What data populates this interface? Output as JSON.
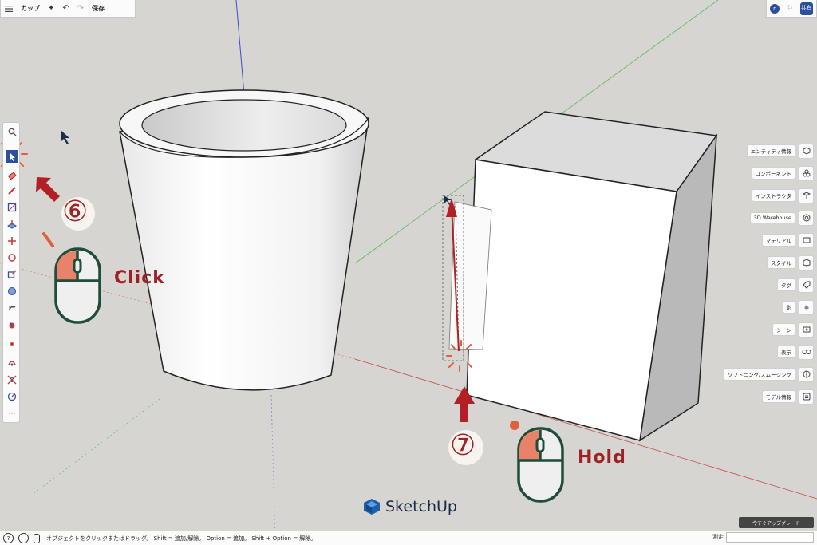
{
  "topbar": {
    "menu_icon": "hamburger-icon",
    "title": "カップ",
    "save_label": "保存"
  },
  "account": {
    "avatar_initial": "n",
    "share_label": "共有"
  },
  "left_tools": [
    "search-icon",
    "select-icon",
    "eraser-icon",
    "pencil-icon",
    "shape-icon",
    "push-pull-icon",
    "move-icon",
    "rotate-icon",
    "scale-icon",
    "paint-bucket-icon",
    "offset-icon",
    "tape-measure-icon",
    "follow-me-icon",
    "orbit-icon",
    "zoom-extents-icon",
    "more-icon"
  ],
  "panel": {
    "items": [
      {
        "label": "エンティティ情報",
        "icon": "entity-info-icon"
      },
      {
        "label": "コンポーネント",
        "icon": "components-icon"
      },
      {
        "label": "インストラクタ",
        "icon": "instructor-icon"
      },
      {
        "label": "3D Warehouse",
        "icon": "warehouse-icon"
      },
      {
        "label": "マテリアル",
        "icon": "materials-icon"
      },
      {
        "label": "スタイル",
        "icon": "styles-icon"
      },
      {
        "label": "タグ",
        "icon": "tags-icon"
      },
      {
        "label": "影",
        "icon": "shadows-icon"
      },
      {
        "label": "シーン",
        "icon": "scenes-icon"
      },
      {
        "label": "表示",
        "icon": "display-icon"
      },
      {
        "label": "ソフトニング/スムージング",
        "icon": "soften-icon"
      },
      {
        "label": "モデル情報",
        "icon": "model-info-icon"
      }
    ]
  },
  "annotations": {
    "step6": "⑥",
    "step7": "⑦",
    "click_label": "Click",
    "hold_label": "Hold"
  },
  "brand": {
    "name": "SketchUp"
  },
  "upgrade_label": "今すぐアップグレード",
  "status": {
    "message": "オブジェクトをクリックまたはドラッグ。 Shift = 追加/解除。 Option = 追加。 Shift + Option = 解除。",
    "measure_label": "測定"
  },
  "colors": {
    "accent_red": "#9d2225",
    "salmon": "#e8836a",
    "mouse_outline": "#1e4d3a",
    "axis_blue": "#3a4fc8",
    "axis_green": "#4caf50",
    "axis_red": "#c64a4a"
  }
}
